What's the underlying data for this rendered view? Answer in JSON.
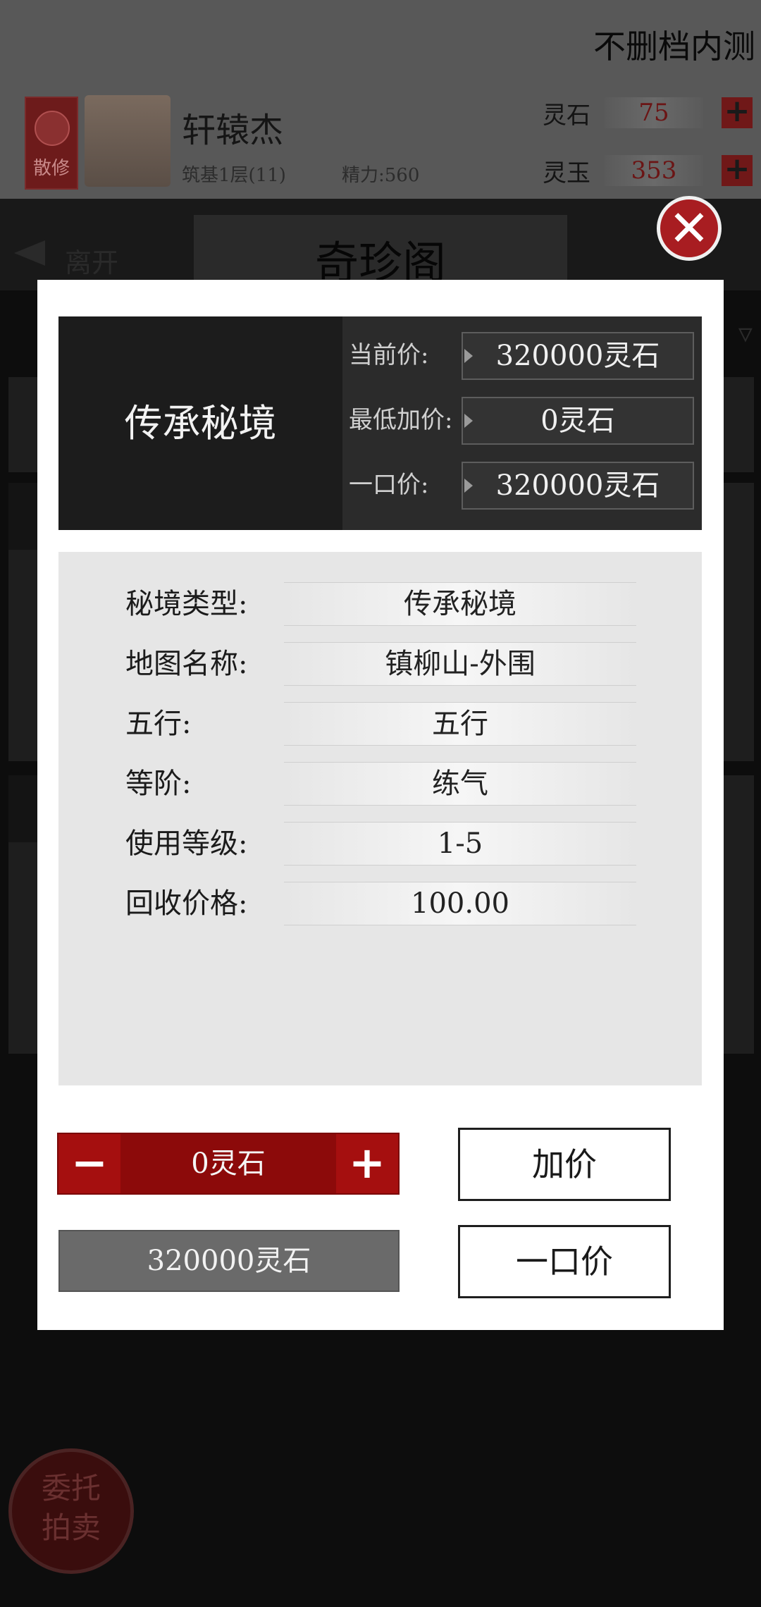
{
  "topbar": {
    "beta_label": "不删档内测",
    "sect_badge": "散修",
    "player": {
      "name": "轩辕杰",
      "level": "筑基1层(11)",
      "energy": "精力:560"
    },
    "currencies": [
      {
        "label": "灵石",
        "value": "75"
      },
      {
        "label": "灵玉",
        "value": "353"
      }
    ]
  },
  "nav": {
    "leave_label": "离开",
    "title": "奇珍阁"
  },
  "commission_button": {
    "line1": "委托",
    "line2": "拍卖"
  },
  "modal": {
    "item_name": "传承秘境",
    "prices": [
      {
        "label": "当前价:",
        "value": "320000灵石"
      },
      {
        "label": "最低加价:",
        "value": "0灵石"
      },
      {
        "label": "一口价:",
        "value": "320000灵石"
      }
    ],
    "attributes": [
      {
        "label": "秘境类型:",
        "value": "传承秘境"
      },
      {
        "label": "地图名称:",
        "value": "镇柳山-外围"
      },
      {
        "label": "五行:",
        "value": "五行"
      },
      {
        "label": "等阶:",
        "value": "练气"
      },
      {
        "label": "使用等级:",
        "value": "1-5"
      },
      {
        "label": "回收价格:",
        "value": "100.00"
      }
    ],
    "bid_amount": "0灵石",
    "buyout_amount": "320000灵石",
    "raise_button": "加价",
    "buyout_button": "一口价"
  },
  "colors": {
    "accent_red": "#8c0a0a",
    "close_red": "#a81d21"
  }
}
